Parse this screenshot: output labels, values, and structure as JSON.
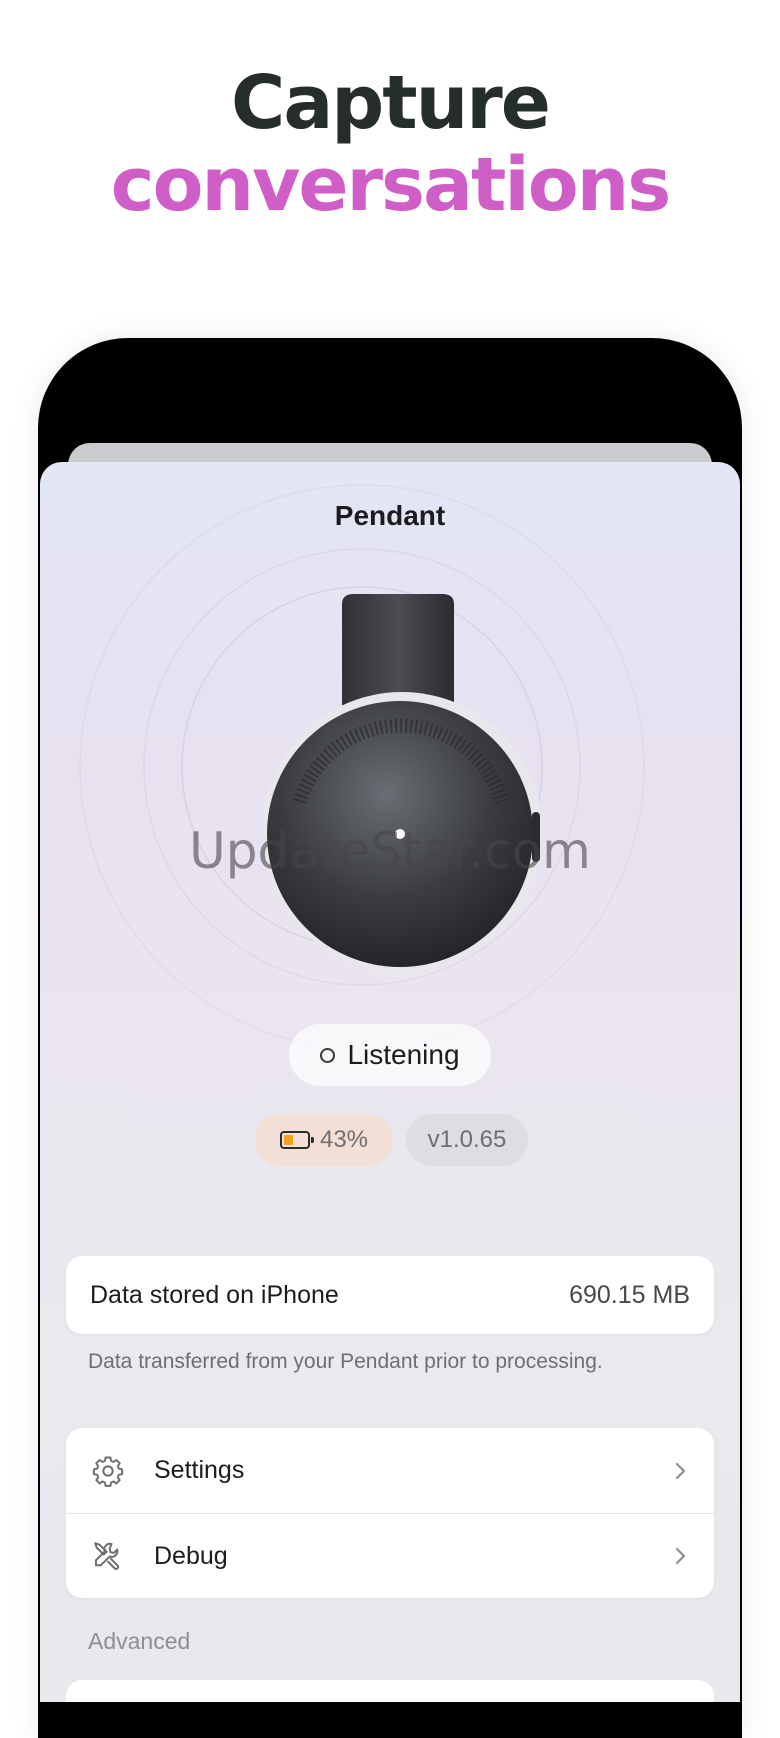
{
  "headline": {
    "line1": "Capture",
    "line2": "conversations"
  },
  "screen": {
    "title": "Pendant",
    "status": {
      "label": "Listening"
    },
    "battery": {
      "percent_text": "43%",
      "level": 0.43
    },
    "version": "v1.0.65",
    "storage": {
      "label": "Data stored on iPhone",
      "value": "690.15 MB",
      "note": "Data transferred from your Pendant prior to processing."
    },
    "menu": [
      {
        "label": "Settings",
        "icon": "gear-icon"
      },
      {
        "label": "Debug",
        "icon": "wrench-screwdriver-icon"
      }
    ],
    "section_advanced": "Advanced"
  },
  "watermark": "UpdateStar.com",
  "colors": {
    "headline_dark": "#262e2a",
    "headline_accent": "#cf5ec6",
    "battery_fill": "#f0a21a",
    "battery_badge_bg": "#f4dfd7"
  }
}
